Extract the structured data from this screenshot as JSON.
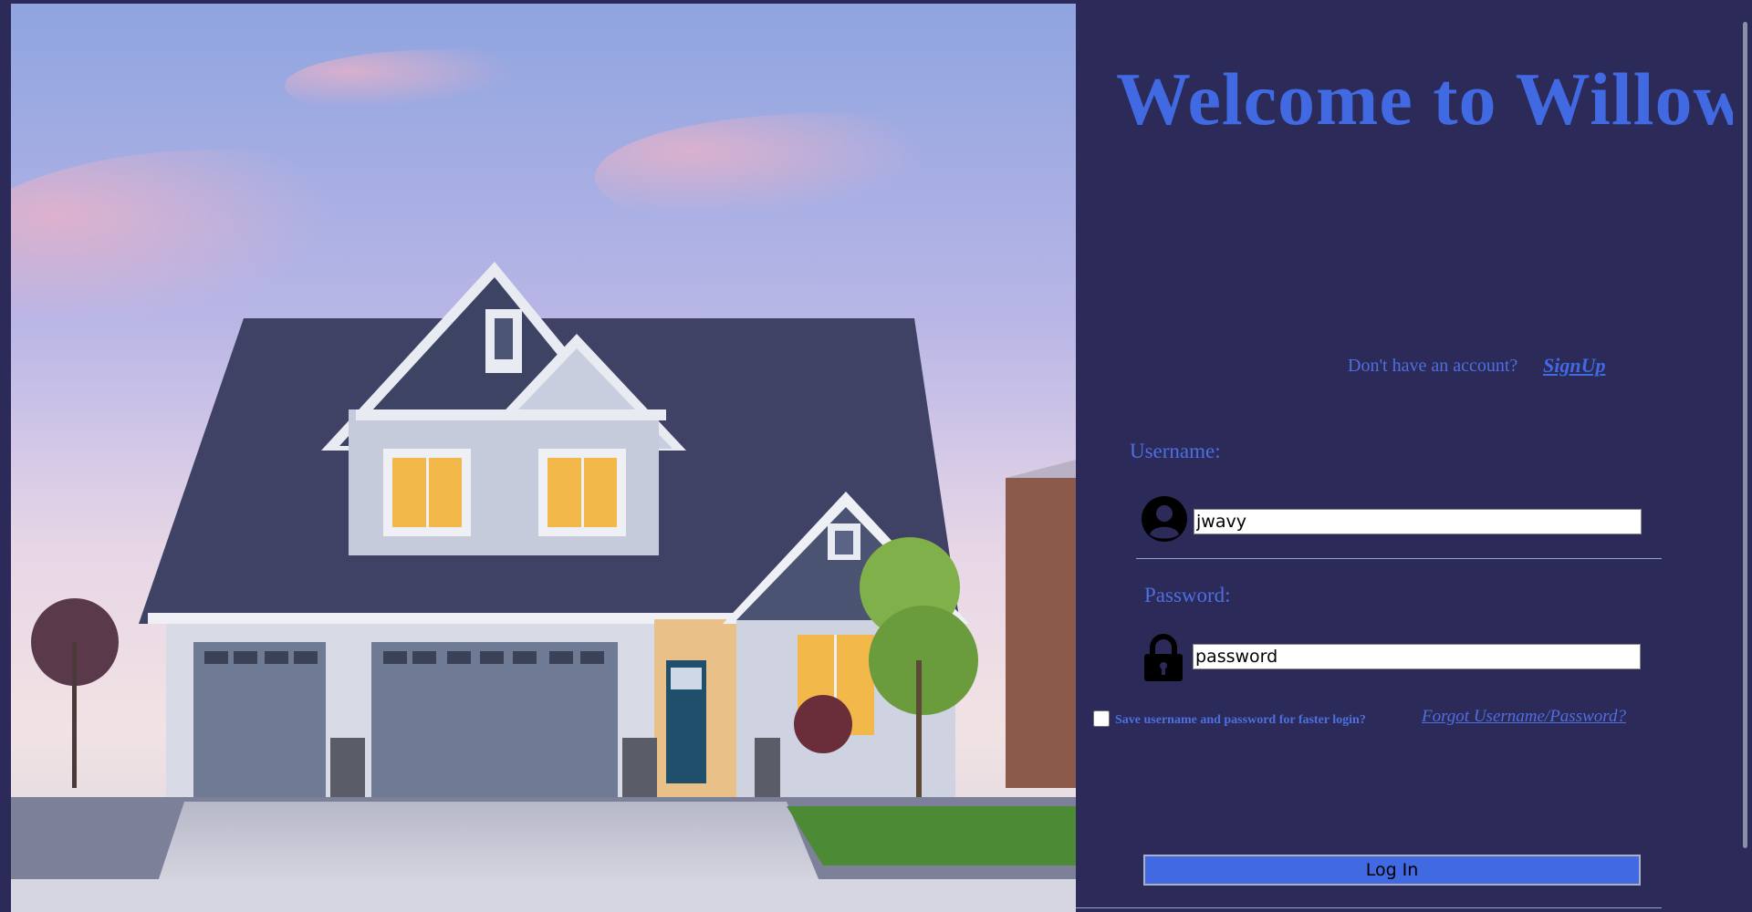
{
  "hero": {
    "image_alt": "two-story house at dusk"
  },
  "login": {
    "title": "Welcome to Willow",
    "no_account_text": "Don't have an account?",
    "signup_link": "SignUp",
    "username_label": "Username:",
    "username_value": "jwavy",
    "password_label": "Password:",
    "password_value": "password",
    "save_label": "Save username and password for faster login?",
    "save_checked": false,
    "forgot_link": "Forgot Username/Password?",
    "login_button": "Log In"
  },
  "icons": {
    "user": "user-avatar-icon",
    "lock": "padlock-icon"
  },
  "colors": {
    "background": "#2b2a58",
    "accent": "#4169e1",
    "label": "#4e6fe0"
  }
}
